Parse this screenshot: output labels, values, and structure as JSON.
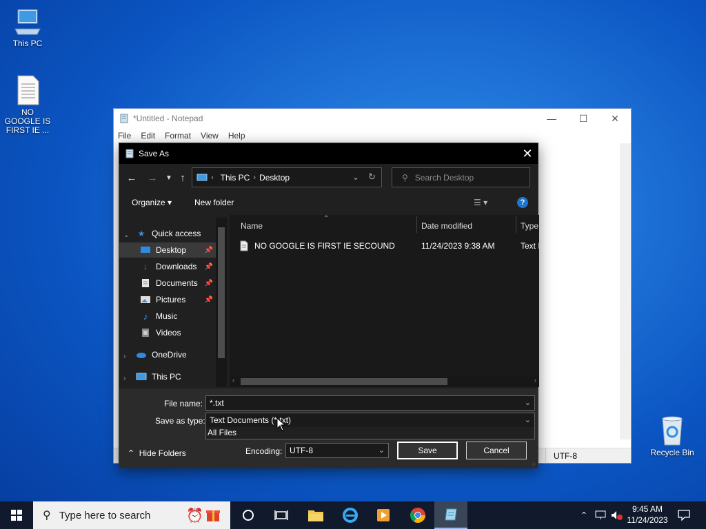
{
  "desktop": {
    "icons": [
      {
        "label": "This PC",
        "icon": "computer-icon"
      },
      {
        "label": "NO GOOGLE IS FIRST IE ...",
        "icon": "text-file-icon"
      },
      {
        "label": "Recycle Bin",
        "icon": "recycle-bin-icon"
      }
    ]
  },
  "notepad": {
    "title": "*Untitled - Notepad",
    "menu": [
      "File",
      "Edit",
      "Format",
      "View",
      "Help"
    ],
    "status_encoding": "UTF-8"
  },
  "dialog": {
    "title": "Save As",
    "address": {
      "root": "This PC",
      "current": "Desktop"
    },
    "search_placeholder": "Search Desktop",
    "toolbar": {
      "organize": "Organize",
      "new_folder": "New folder"
    },
    "nav_pane": {
      "quick_access": "Quick access",
      "items": [
        {
          "label": "Desktop",
          "icon": "desktop-folder-icon",
          "pinned": true,
          "selected": true
        },
        {
          "label": "Downloads",
          "icon": "downloads-icon",
          "pinned": true
        },
        {
          "label": "Documents",
          "icon": "documents-icon",
          "pinned": true
        },
        {
          "label": "Pictures",
          "icon": "pictures-icon",
          "pinned": true
        },
        {
          "label": "Music",
          "icon": "music-icon"
        },
        {
          "label": "Videos",
          "icon": "videos-icon"
        }
      ],
      "onedrive": "OneDrive",
      "this_pc": "This PC"
    },
    "columns": {
      "name": "Name",
      "date_modified": "Date modified",
      "type": "Type"
    },
    "files": [
      {
        "name": "NO GOOGLE IS FIRST IE SECOUND",
        "date_modified": "11/24/2023 9:38 AM",
        "type": "Text D"
      }
    ],
    "file_name_label": "File name:",
    "file_name_value": "*.txt",
    "save_as_type_label": "Save as type:",
    "save_as_type_value": "Text Documents (*.txt)",
    "save_as_type_options": [
      "All Files"
    ],
    "hide_folders": "Hide Folders",
    "encoding_label": "Encoding:",
    "encoding_value": "UTF-8",
    "save_button": "Save",
    "cancel_button": "Cancel"
  },
  "taskbar": {
    "search_placeholder": "Type here to search",
    "time": "9:45 AM",
    "date": "11/24/2023"
  },
  "colors": {
    "accent": "#1e74d0",
    "dialog_bg": "#202020",
    "taskbar_bg": "#101a2c"
  }
}
